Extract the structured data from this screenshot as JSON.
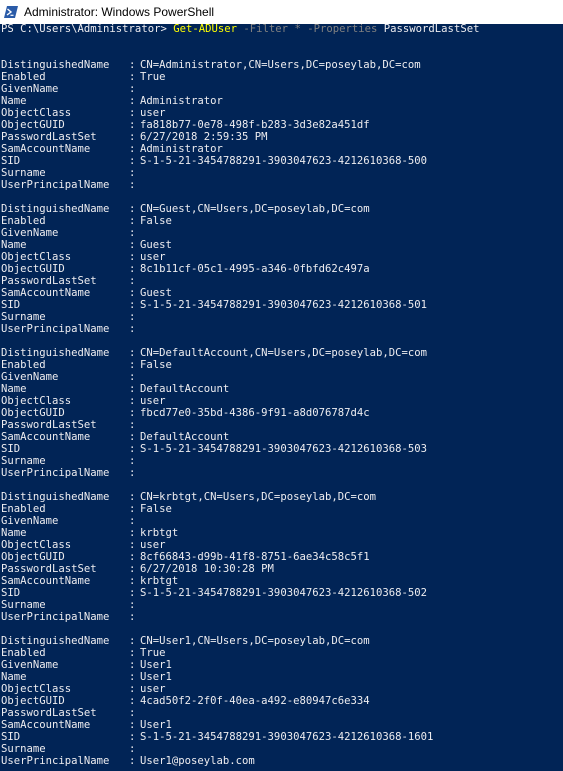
{
  "window": {
    "title": "Administrator: Windows PowerShell",
    "icon": "powershell-icon"
  },
  "colors": {
    "console_background": "#012456",
    "console_text": "#eeedf0",
    "cmdlet": "#ffff00",
    "parameter": "#808080"
  },
  "prompt": {
    "path": "PS C:\\Users\\Administrator> ",
    "cmdlet": "Get-ADUser",
    "param_filter": "-Filter",
    "filter_value": "*",
    "param_properties": "-Properties",
    "properties_value": "PasswordLastSet"
  },
  "property_names": [
    "DistinguishedName",
    "Enabled",
    "GivenName",
    "Name",
    "ObjectClass",
    "ObjectGUID",
    "PasswordLastSet",
    "SamAccountName",
    "SID",
    "Surname",
    "UserPrincipalName"
  ],
  "separator": ":",
  "users": [
    {
      "values": [
        "CN=Administrator,CN=Users,DC=poseylab,DC=com",
        "True",
        "",
        "Administrator",
        "user",
        "fa818b77-0e78-498f-b283-3d3e82a451df",
        "6/27/2018 2:59:35 PM",
        "Administrator",
        "S-1-5-21-3454788291-3903047623-4212610368-500",
        "",
        ""
      ]
    },
    {
      "values": [
        "CN=Guest,CN=Users,DC=poseylab,DC=com",
        "False",
        "",
        "Guest",
        "user",
        "8c1b11cf-05c1-4995-a346-0fbfd62c497a",
        "",
        "Guest",
        "S-1-5-21-3454788291-3903047623-4212610368-501",
        "",
        ""
      ]
    },
    {
      "values": [
        "CN=DefaultAccount,CN=Users,DC=poseylab,DC=com",
        "False",
        "",
        "DefaultAccount",
        "user",
        "fbcd77e0-35bd-4386-9f91-a8d076787d4c",
        "",
        "DefaultAccount",
        "S-1-5-21-3454788291-3903047623-4212610368-503",
        "",
        ""
      ]
    },
    {
      "values": [
        "CN=krbtgt,CN=Users,DC=poseylab,DC=com",
        "False",
        "",
        "krbtgt",
        "user",
        "8cf66843-d99b-41f8-8751-6ae34c58c5f1",
        "6/27/2018 10:30:28 PM",
        "krbtgt",
        "S-1-5-21-3454788291-3903047623-4212610368-502",
        "",
        ""
      ]
    },
    {
      "values": [
        "CN=User1,CN=Users,DC=poseylab,DC=com",
        "True",
        "User1",
        "User1",
        "user",
        "4cad50f2-2f0f-40ea-a492-e80947c6e334",
        "",
        "User1",
        "S-1-5-21-3454788291-3903047623-4212610368-1601",
        "",
        "User1@poseylab.com"
      ]
    }
  ]
}
